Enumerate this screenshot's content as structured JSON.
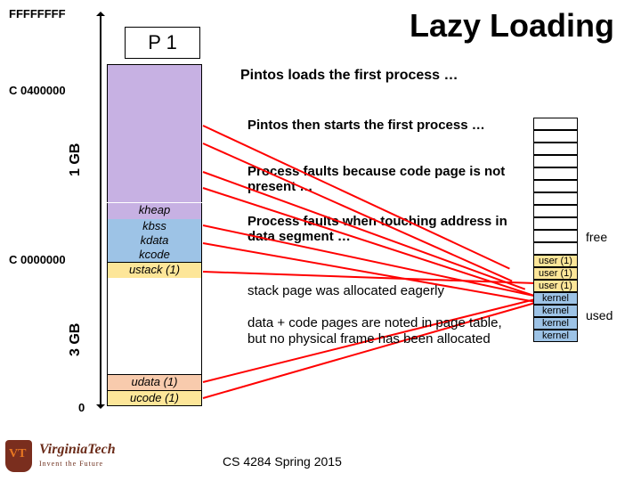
{
  "title": "Lazy Loading",
  "column_header": "P 1",
  "addresses": {
    "top": "FFFFFFFF",
    "mid_upper": "C 0400000",
    "mid_lower": "C 0000000",
    "bottom": "0"
  },
  "gb_labels": {
    "one": "1 GB",
    "three": "3 GB"
  },
  "kernel_segments": {
    "kheap": "kheap",
    "kbss": "kbss",
    "kdata": "kdata",
    "kcode": "kcode",
    "ustack": "ustack (1)"
  },
  "user_segments": {
    "udata": "udata (1)",
    "ucode": "ucode (1)"
  },
  "subtitle": "Pintos loads the first process …",
  "explanations": {
    "e1": "Pintos then starts the first process …",
    "e2": "Process faults because code page is not present …",
    "e3": "Process faults when touching address in data segment …"
  },
  "plain_texts": {
    "p1": "stack page was allocated eagerly",
    "p2": "data + code pages are noted in page table, but no physical frame has been allocated"
  },
  "frames": {
    "user": "user (1)",
    "kernel": "kernel"
  },
  "side_labels": {
    "free": "free",
    "used": "used"
  },
  "footer": "CS 4284 Spring 2015",
  "logo": {
    "line1": "Virginia",
    "line2": "Tech",
    "tag": "Invent the Future"
  }
}
